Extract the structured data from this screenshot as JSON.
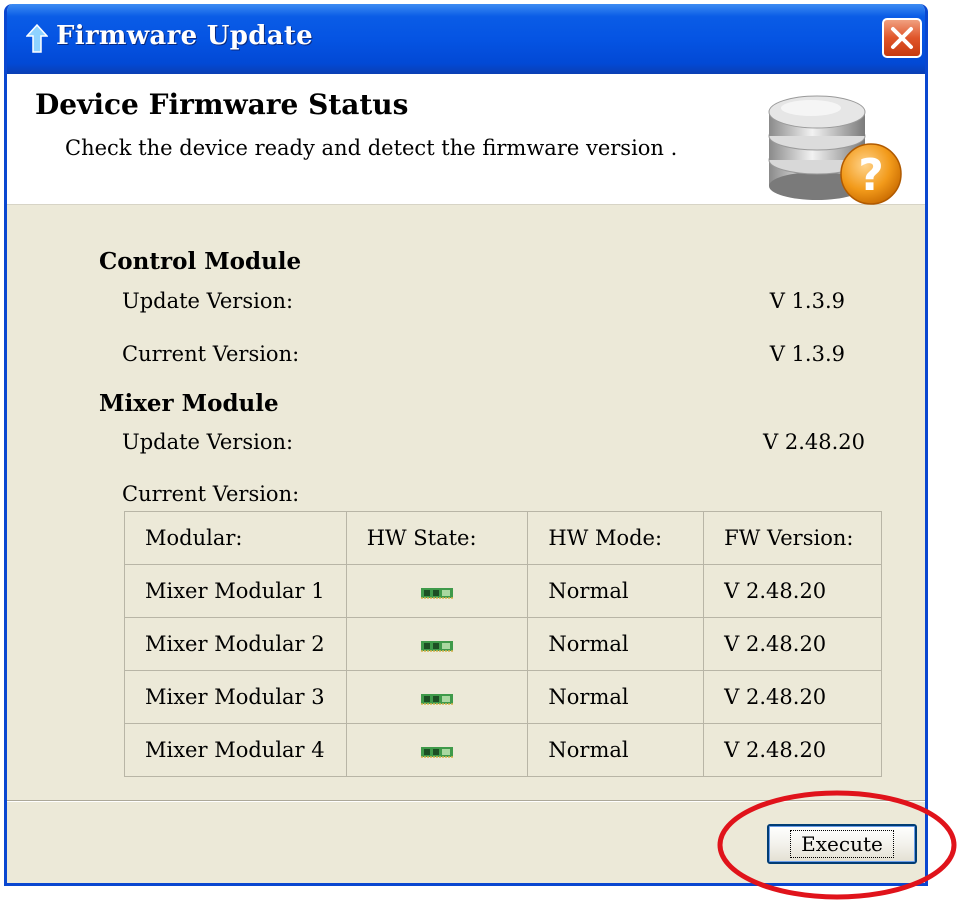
{
  "window": {
    "title": "Firmware Update",
    "title_icon": "upload-arrow-icon",
    "close_icon": "close-icon"
  },
  "header": {
    "title": "Device Firmware Status",
    "description": "Check the device ready and detect the firmware version .",
    "icon": "database-question-icon"
  },
  "control_module": {
    "title": "Control Module",
    "update_label": "Update Version:",
    "update_value": "V 1.3.9",
    "current_label": "Current Version:",
    "current_value": "V 1.3.9"
  },
  "mixer_module": {
    "title": "Mixer Module",
    "update_label": "Update Version:",
    "update_value": "V 2.48.20",
    "current_label": "Current Version:",
    "table": {
      "headers": [
        "Modular:",
        "HW State:",
        "HW Mode:",
        "FW Version:"
      ],
      "rows": [
        {
          "modular": "Mixer Modular 1",
          "state_icon": "circuit-board-icon",
          "mode": "Normal",
          "fw": "V 2.48.20"
        },
        {
          "modular": "Mixer Modular 2",
          "state_icon": "circuit-board-icon",
          "mode": "Normal",
          "fw": "V 2.48.20"
        },
        {
          "modular": "Mixer Modular 3",
          "state_icon": "circuit-board-icon",
          "mode": "Normal",
          "fw": "V 2.48.20"
        },
        {
          "modular": "Mixer Modular 4",
          "state_icon": "circuit-board-icon",
          "mode": "Normal",
          "fw": "V 2.48.20"
        }
      ]
    }
  },
  "footer": {
    "execute_label": "Execute"
  },
  "colors": {
    "titlebar": "#0554e3",
    "window_bg": "#ece9d8",
    "annotation": "#e0131b"
  }
}
